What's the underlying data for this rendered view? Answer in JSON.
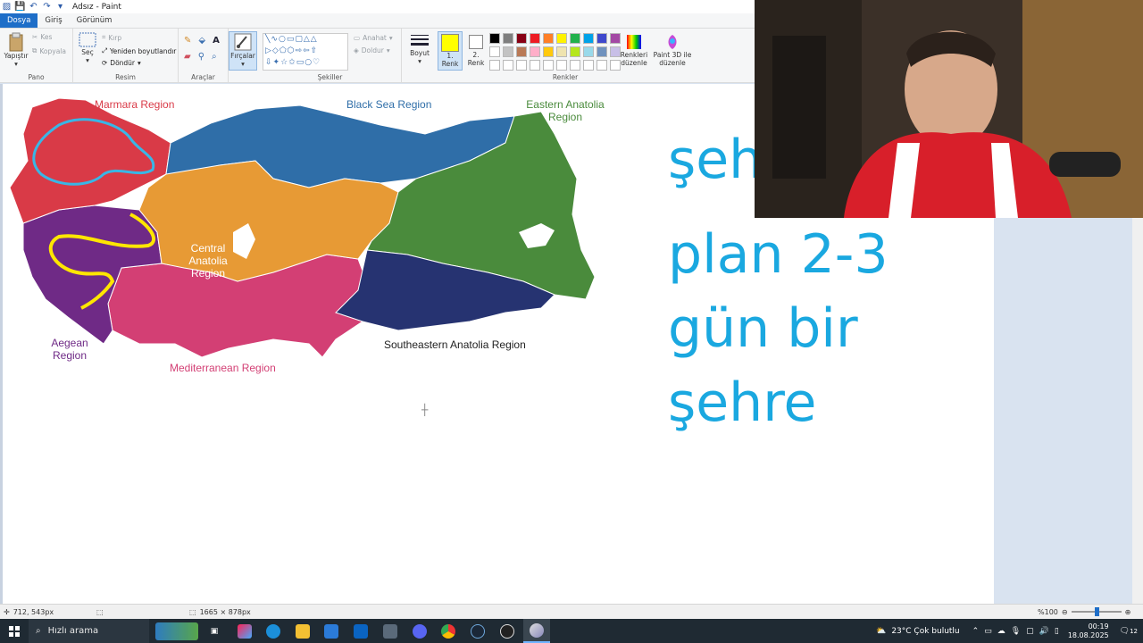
{
  "window": {
    "title": "Adsız - Paint"
  },
  "tabs": [
    "Dosya",
    "Giriş",
    "Görünüm"
  ],
  "ribbon": {
    "clipboard": {
      "paste": "Yapıştır",
      "cut": "Kes",
      "copy": "Kopyala",
      "label": "Pano"
    },
    "image": {
      "select": "Seç",
      "crop": "Kırp",
      "resize": "Yeniden boyutlandır",
      "rotate": "Döndür",
      "label": "Resim"
    },
    "tools": {
      "label": "Araçlar",
      "brushes": "Fırçalar"
    },
    "shapes": {
      "outline": "Anahat",
      "fill": "Doldur",
      "label": "Şekiller"
    },
    "size": "Boyut",
    "colors": {
      "color1": "1. Renk",
      "color2": "2. Renk",
      "edit": "Renkleri düzenle",
      "paint3d": "Paint 3D ile düzenle",
      "label": "Renkler",
      "color1_value": "#ffff00",
      "color2_value": "#ffffff",
      "palette": [
        "#000000",
        "#7f7f7f",
        "#880015",
        "#ed1c24",
        "#ff7f27",
        "#fff200",
        "#22b14c",
        "#00a2e8",
        "#3f48cc",
        "#a349a4",
        "#ffffff",
        "#c3c3c3",
        "#b97a57",
        "#ffaec9",
        "#ffc90e",
        "#efe4b0",
        "#b5e61d",
        "#99d9ea",
        "#7092be",
        "#c8bfe7",
        "#ffffff",
        "#ffffff",
        "#ffffff",
        "#ffffff",
        "#ffffff",
        "#ffffff",
        "#ffffff",
        "#ffffff",
        "#ffffff",
        "#ffffff"
      ]
    }
  },
  "map": {
    "labels": {
      "marmara": "Marmara Region",
      "black_sea": "Black Sea Region",
      "eastern": "Eastern Anatolia Region",
      "central": "Central Anatolia Region",
      "aegean": "Aegean Region",
      "mediterranean": "Mediterranean Region",
      "southeastern": "Southeastern Anatolia Region"
    },
    "colors": {
      "marmara": "#d93a47",
      "black_sea": "#2f6ea8",
      "eastern": "#4a8b3c",
      "central": "#e79a35",
      "aegean": "#6f2a86",
      "mediterranean": "#d33f74",
      "southeastern": "#263371"
    }
  },
  "canvas_text": [
    "şeh",
    "plan 2-3",
    "gün bir",
    "şehre"
  ],
  "statusbar": {
    "cursor_pos": "712, 543px",
    "image_size": "1665 × 878px",
    "zoom": "%100"
  },
  "taskbar": {
    "search_placeholder": "Hızlı arama",
    "weather": "23°C  Çok bulutlu",
    "time": "00:19",
    "date": "18.08.2025",
    "notifications": "12"
  }
}
